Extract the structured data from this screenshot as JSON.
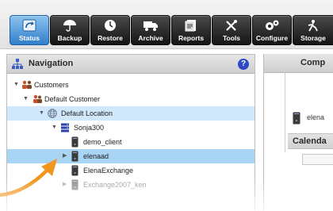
{
  "toolbar": {
    "buttons": [
      {
        "label": "Status",
        "icon": "status-icon",
        "active": true
      },
      {
        "label": "Backup",
        "icon": "umbrella-icon"
      },
      {
        "label": "Restore",
        "icon": "clock-icon"
      },
      {
        "label": "Archive",
        "icon": "truck-icon"
      },
      {
        "label": "Reports",
        "icon": "reports-icon"
      },
      {
        "label": "Tools",
        "icon": "tools-icon"
      },
      {
        "label": "Configure",
        "icon": "gears-icon"
      },
      {
        "label": "Storage",
        "icon": "storage-icon"
      }
    ]
  },
  "navigation": {
    "title": "Navigation",
    "help": "?",
    "tree": [
      {
        "label": "Customers",
        "icon": "customers-icon"
      },
      {
        "label": "Default Customer",
        "icon": "customer-icon"
      },
      {
        "label": "Default Location",
        "icon": "globe-icon"
      },
      {
        "label": "Sonja300",
        "icon": "server-icon"
      },
      {
        "label": "demo_client",
        "icon": "client-icon"
      },
      {
        "label": "elenaad",
        "icon": "client-icon"
      },
      {
        "label": "ElenaExchange",
        "icon": "client-icon"
      },
      {
        "label": "Exchange2007_ken",
        "icon": "client-icon"
      }
    ]
  },
  "computer_panel": {
    "title": "Comp",
    "item": "elena",
    "calendar_title": "Calenda"
  },
  "colors": {
    "accent": "#2f7fcb",
    "selection": "#a9d5f5",
    "arrow": "#f0961e"
  }
}
